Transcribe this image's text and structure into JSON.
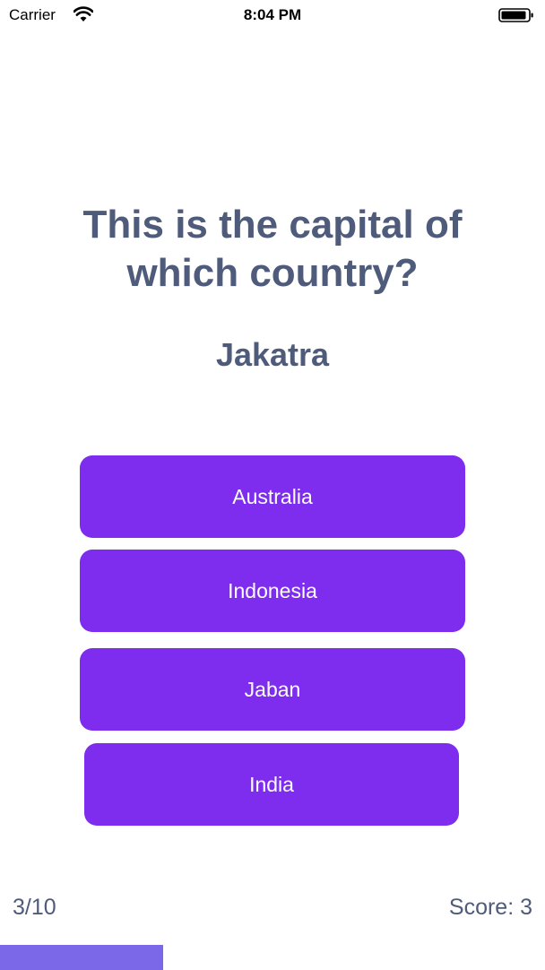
{
  "status_bar": {
    "carrier": "Carrier",
    "time": "8:04 PM",
    "wifi_icon": "wifi-icon",
    "battery_icon": "battery-icon"
  },
  "quiz": {
    "question": "This is the capital of which country?",
    "subject": "Jakatra",
    "answers": [
      "Australia",
      "Indonesia",
      "Jaban",
      "India"
    ]
  },
  "footer": {
    "progress_label": "3/10",
    "score_label": "Score: 3",
    "progress_fraction": 0.3
  },
  "colors": {
    "text": "#4f5b7a",
    "button": "#7e2cee",
    "progress": "#7b68e8"
  }
}
